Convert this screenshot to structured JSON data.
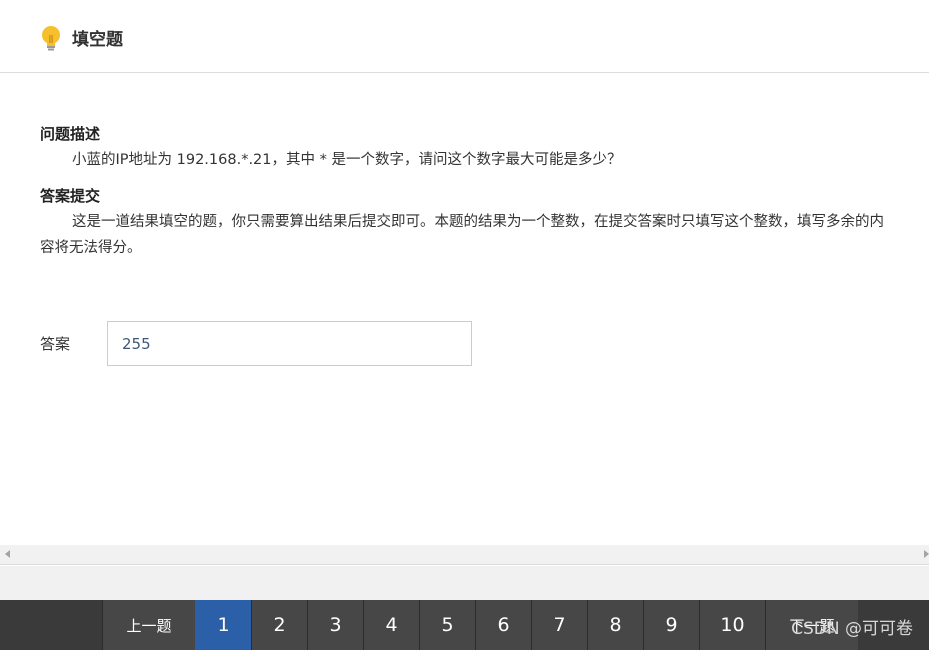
{
  "header": {
    "icon": "lightbulb-icon",
    "title": "填空题"
  },
  "question": {
    "section_title": "问题描述",
    "text": "小蓝的IP地址为 192.168.*.21，其中 * 是一个数字，请问这个数字最大可能是多少？"
  },
  "submission": {
    "section_title": "答案提交",
    "text": "这是一道结果填空的题，你只需要算出结果后提交即可。本题的结果为一个整数，在提交答案时只填写这个整数，填写多余的内容将无法得分。"
  },
  "answer": {
    "label": "答案",
    "value": "255"
  },
  "pagination": {
    "prev_label": "上一题",
    "next_label": "下一题",
    "pages": [
      "1",
      "2",
      "3",
      "4",
      "5",
      "6",
      "7",
      "8",
      "9",
      "10"
    ],
    "current_page": "1",
    "active_color": "#2b5fa8",
    "bar_color": "#3a3a3a"
  },
  "watermark": "CSDN @可可卷"
}
